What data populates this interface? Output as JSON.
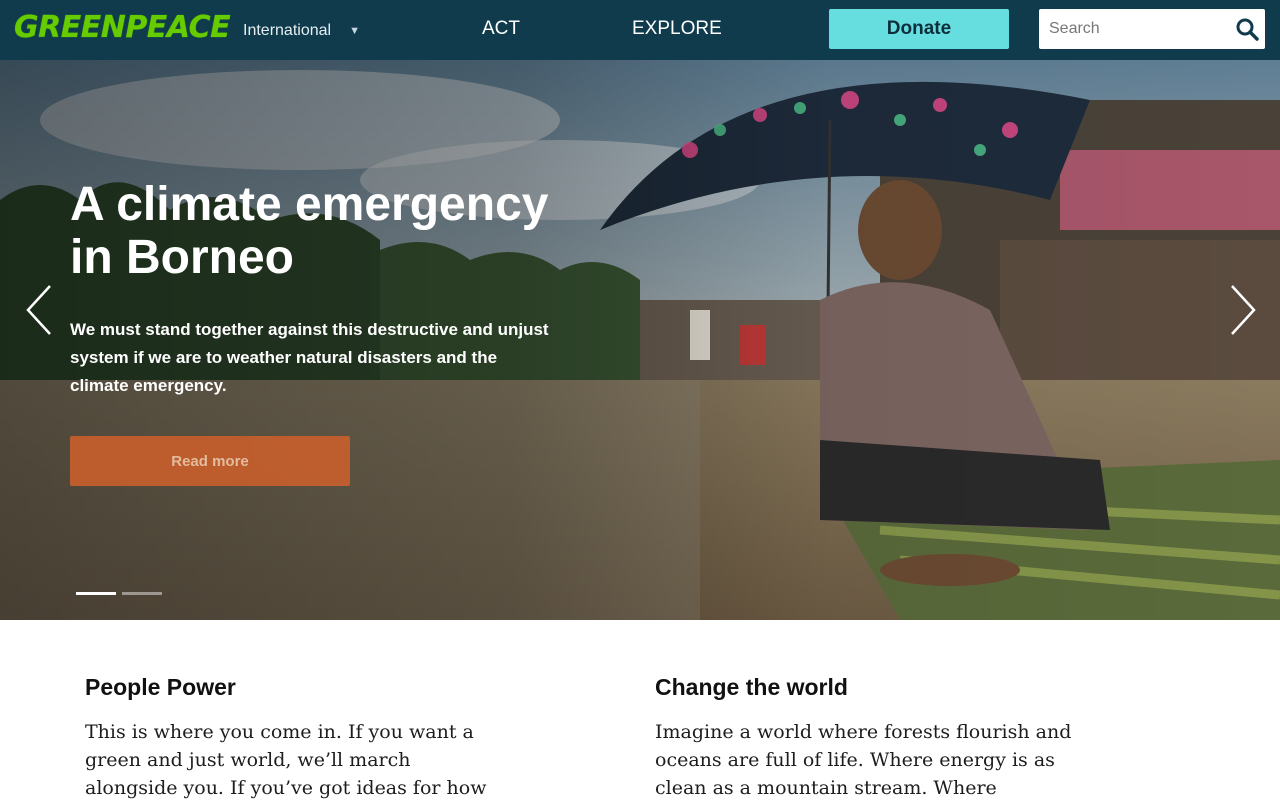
{
  "header": {
    "logo_text": "GREENPEACE",
    "country_selector": "International",
    "nav": [
      "ACT",
      "EXPLORE"
    ],
    "donate_label": "Donate",
    "search_placeholder": "Search"
  },
  "hero": {
    "title": "A climate emergency in Borneo",
    "body": "We must stand together against this destructive and unjust system if we are to weather natural disasters and the climate emergency.",
    "cta_label": "Read more",
    "slides_count": 2,
    "active_slide": 1
  },
  "sections": [
    {
      "heading": "People Power",
      "text": "This is where you come in. If you want a green and just world, we’ll march alongside you. If you’ve got ideas for how to get there,"
    },
    {
      "heading": "Change the world",
      "text": "Imagine a world where forests flourish and oceans are full of life. Where energy is as clean as a mountain stream. Where"
    }
  ],
  "colors": {
    "header_bg": "#0f3b4d",
    "logo_green": "#66cc00",
    "donate_bg": "#66dddf",
    "cta_bg": "#c95f2c"
  },
  "icons": {
    "search": "search-icon",
    "dropdown": "chevron-down-icon",
    "prev": "chevron-left-icon",
    "next": "chevron-right-icon"
  }
}
